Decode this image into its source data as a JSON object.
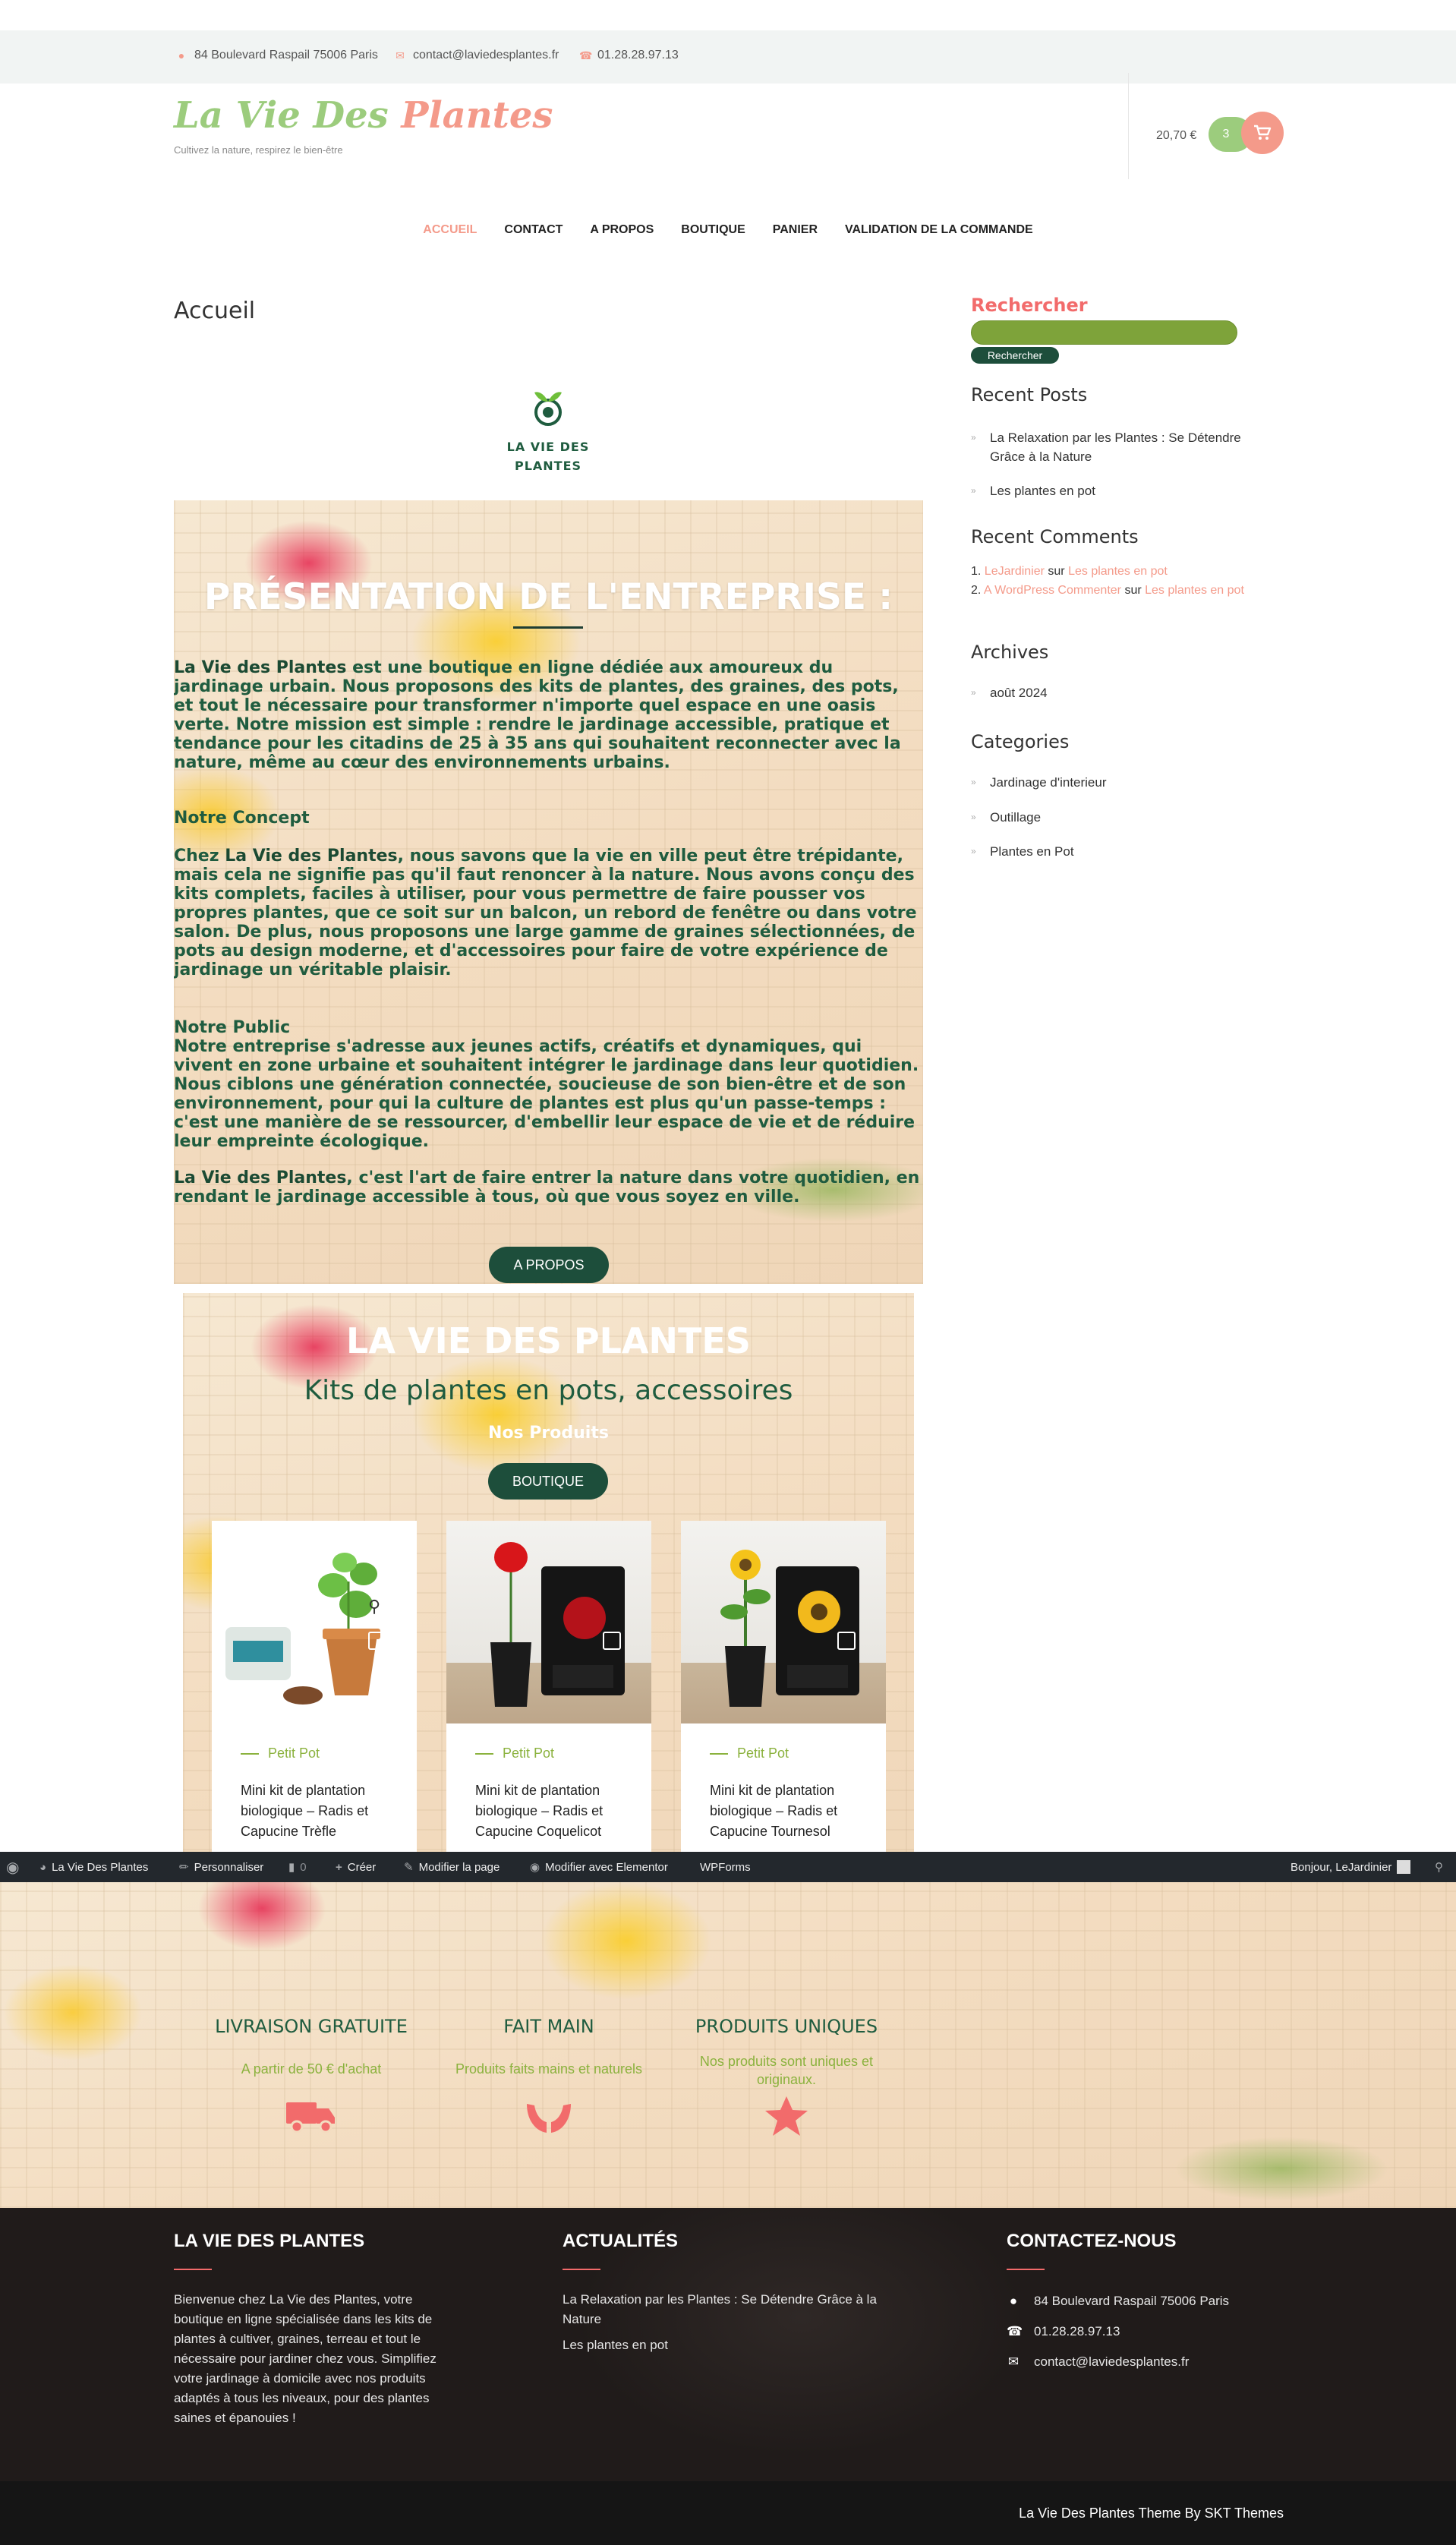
{
  "topbar": {
    "address": "84 Boulevard Raspail 75006 Paris",
    "email": "contact@laviedesplantes.fr",
    "phone": "01.28.28.97.13"
  },
  "header": {
    "logo_part1": "La Vie Des ",
    "logo_part2": "Plantes",
    "tagline": "Cultivez la nature, respirez le bien-être",
    "cart_total": "20,70 €",
    "cart_count": "3"
  },
  "nav": [
    {
      "label": "ACCUEIL",
      "active": true
    },
    {
      "label": "CONTACT"
    },
    {
      "label": "A PROPOS"
    },
    {
      "label": "BOUTIQUE"
    },
    {
      "label": "PANIER"
    },
    {
      "label": "VALIDATION DE LA COMMANDE"
    }
  ],
  "main": {
    "page_title": "Accueil",
    "content_logo_line1": "LA VIE DES",
    "content_logo_line2": "PLANTES",
    "intro": {
      "heading": "PRÉSENTATION DE L'ENTREPRISE :",
      "p1_strong": "La Vie des Plantes",
      "p1": " est une boutique en ligne dédiée aux amoureux du jardinage urbain. Nous proposons des kits de plantes, des graines, des pots, et tout le nécessaire pour transformer n'importe quel espace en une oasis verte. Notre mission est simple : rendre le jardinage accessible, pratique et tendance pour les citadins de 25 à 35 ans qui souhaitent reconnecter avec la nature, même au cœur des environnements urbains.",
      "concept_title": "Notre Concept",
      "concept_pre": "Chez ",
      "concept_strong": "La Vie des Plantes",
      "concept_text": ", nous savons que la vie en ville peut être trépidante, mais cela ne signifie pas qu'il faut renoncer à la nature. Nous avons conçu des kits complets, faciles à utiliser, pour vous permettre de faire pousser vos propres plantes, que ce soit sur un balcon, un rebord de fenêtre ou dans votre salon. De plus, nous proposons une large gamme de graines sélectionnées, de pots au design moderne, et d'accessoires pour faire de votre expérience de jardinage un véritable plaisir.",
      "public_title": "Notre Public",
      "public_text": "Notre entreprise s'adresse aux jeunes actifs, créatifs et dynamiques, qui vivent en zone urbaine et souhaitent intégrer le jardinage dans leur quotidien. Nous ciblons une génération connectée, soucieuse de son bien-être et de son environnement, pour qui la culture de plantes est plus qu'un passe-temps : c'est une manière de se ressourcer, d'embellir leur espace de vie et de réduire leur empreinte écologique.",
      "closing_strong": "La Vie des Plantes",
      "closing_text": ", c'est l'art de faire entrer la nature dans votre quotidien, en rendant le jardinage accessible à tous, où que vous soyez en ville.",
      "button": "A PROPOS"
    },
    "products": {
      "title": "LA VIE DES PLANTES",
      "subtitle": "Kits de plantes en pots, accessoires",
      "our_products": "Nos Produits",
      "button": "BOUTIQUE",
      "items": [
        {
          "category": "Petit Pot",
          "title": "Mini kit de plantation biologique – Radis et Capucine Trèfle"
        },
        {
          "category": "Petit Pot",
          "title": "Mini kit de plantation biologique – Radis et Capucine Coquelicot"
        },
        {
          "category": "Petit Pot",
          "title": "Mini kit de plantation biologique – Radis et Capucine Tournesol"
        }
      ]
    },
    "features": [
      {
        "title": "LIVRAISON GRATUITE",
        "sub": "A partir de 50 € d'achat",
        "icon": "truck-icon"
      },
      {
        "title": "FAIT MAIN",
        "sub": "Produits faits mains et naturels",
        "icon": "hands-icon"
      },
      {
        "title": "PRODUITS UNIQUES",
        "sub": "Nos produits sont uniques et originaux.",
        "icon": "star-icon"
      }
    ]
  },
  "sidebar": {
    "search_title": "Rechercher",
    "search_button": "Rechercher",
    "recent_posts_title": "Recent Posts",
    "recent_posts": [
      "La Relaxation par les Plantes : Se Détendre Grâce à la Nature",
      "Les plantes en pot"
    ],
    "recent_comments_title": "Recent Comments",
    "recent_comments": [
      {
        "author": "LeJardinier",
        "sep": " sur ",
        "post": "Les plantes en pot"
      },
      {
        "author": "A WordPress Commenter",
        "sep": " sur ",
        "post": "Les plantes en pot"
      }
    ],
    "archives_title": "Archives",
    "archives": [
      "août 2024"
    ],
    "categories_title": "Categories",
    "categories": [
      "Jardinage d'interieur",
      "Outillage",
      "Plantes en Pot"
    ]
  },
  "adminbar": {
    "site": "La Vie Des Plantes",
    "customize": "Personnaliser",
    "comments": "0",
    "create": "Créer",
    "edit_page": "Modifier la page",
    "edit_elementor": "Modifier avec Elementor",
    "wpforms": "WPForms",
    "greeting": "Bonjour, LeJardinier"
  },
  "footer": {
    "col1_title": "LA VIE DES PLANTES",
    "col1_text": "Bienvenue chez La Vie des Plantes, votre boutique en ligne spécialisée dans les kits de plantes à cultiver, graines, terreau et tout le nécessaire pour jardiner chez vous. Simplifiez votre jardinage à domicile avec nos produits adaptés à tous les niveaux, pour des plantes saines et épanouies !",
    "col2_title": "ACTUALITÉS",
    "col2_links": [
      "La Relaxation par les Plantes : Se Détendre Grâce à la Nature",
      "Les plantes en pot"
    ],
    "col3_title": "CONTACTEZ-NOUS",
    "col3_address": "84 Boulevard Raspail 75006 Paris",
    "col3_phone": "01.28.28.97.13",
    "col3_email": "contact@laviedesplantes.fr",
    "credit": "La Vie Des Plantes Theme By SKT Themes"
  },
  "colors": {
    "accent_pink": "#f49a8a",
    "accent_green": "#9ccc7d",
    "dark_green": "#1d4e3b",
    "olive": "#8bb23e"
  }
}
